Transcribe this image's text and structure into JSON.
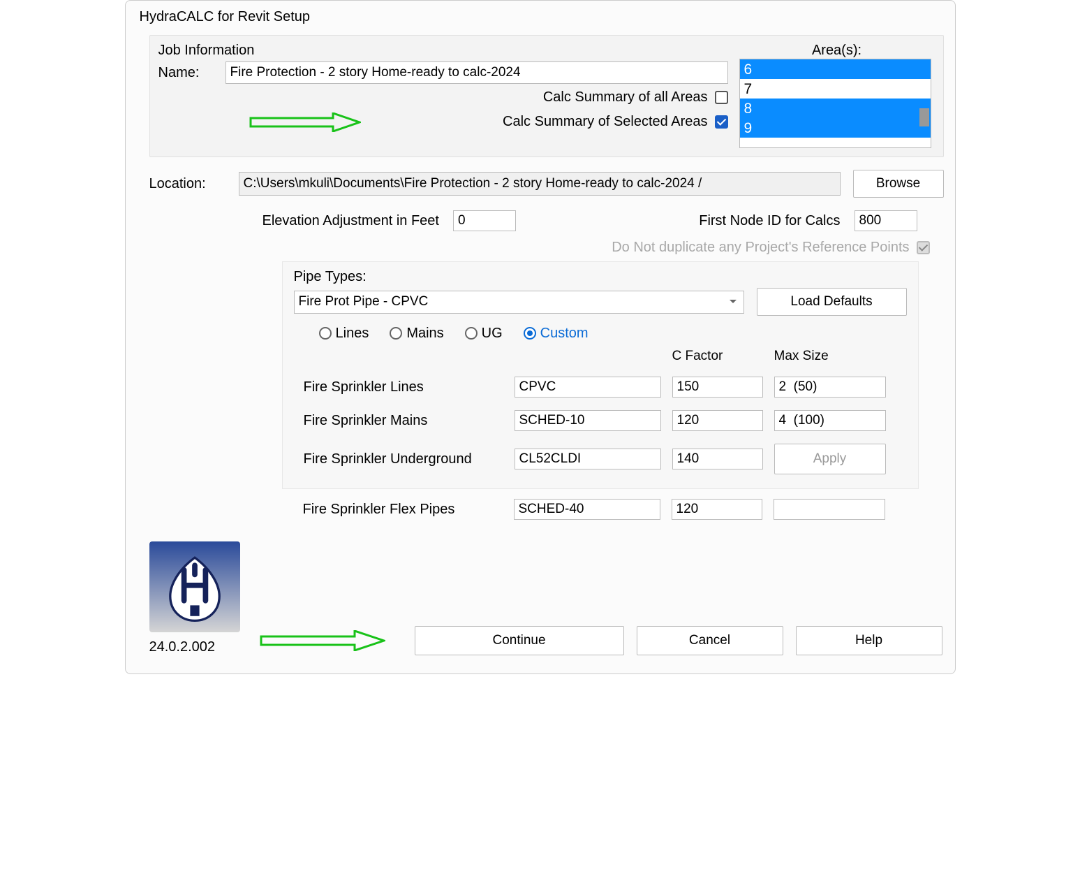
{
  "title": "HydraCALC for Revit Setup",
  "job": {
    "group_label": "Job Information",
    "name_label": "Name:",
    "name_value": "Fire Protection - 2 story Home-ready to calc-2024",
    "calc_all_label": "Calc Summary of all Areas",
    "calc_all_checked": false,
    "calc_selected_label": "Calc Summary of Selected Areas",
    "calc_selected_checked": true,
    "areas_label": "Area(s):",
    "areas": [
      {
        "label": "6",
        "selected": true
      },
      {
        "label": "7",
        "selected": false
      },
      {
        "label": "8",
        "selected": true
      },
      {
        "label": "9",
        "selected": true
      }
    ]
  },
  "location": {
    "label": "Location:",
    "value": "C:\\Users\\mkuli\\Documents\\Fire Protection - 2 story Home-ready to calc-2024 /",
    "browse": "Browse"
  },
  "elevation": {
    "label": "Elevation Adjustment in Feet",
    "value": "0"
  },
  "first_node": {
    "label": "First Node ID for Calcs",
    "value": "800"
  },
  "no_dup": {
    "label": "Do Not duplicate any Project's Reference Points",
    "checked": true
  },
  "pipe": {
    "label": "Pipe Types:",
    "selected": "Fire Prot Pipe - CPVC",
    "load_defaults": "Load Defaults",
    "radios": {
      "lines": "Lines",
      "mains": "Mains",
      "ug": "UG",
      "custom": "Custom",
      "selected": "custom"
    },
    "headers": {
      "cfactor": "C Factor",
      "maxsize": "Max Size"
    },
    "rows": [
      {
        "label": "Fire Sprinkler Lines",
        "type": "CPVC",
        "cfactor": "150",
        "maxsize": "2  (50)"
      },
      {
        "label": "Fire Sprinkler Mains",
        "type": "SCHED-10",
        "cfactor": "120",
        "maxsize": "4  (100)"
      },
      {
        "label": "Fire Sprinkler Underground",
        "type": "CL52CLDI",
        "cfactor": "140",
        "maxsize": ""
      }
    ],
    "apply": "Apply",
    "flex": {
      "label": "Fire Sprinkler Flex Pipes",
      "type": "SCHED-40",
      "cfactor": "120",
      "maxsize": ""
    }
  },
  "version": "24.0.2.002",
  "buttons": {
    "continue": "Continue",
    "cancel": "Cancel",
    "help": "Help"
  }
}
